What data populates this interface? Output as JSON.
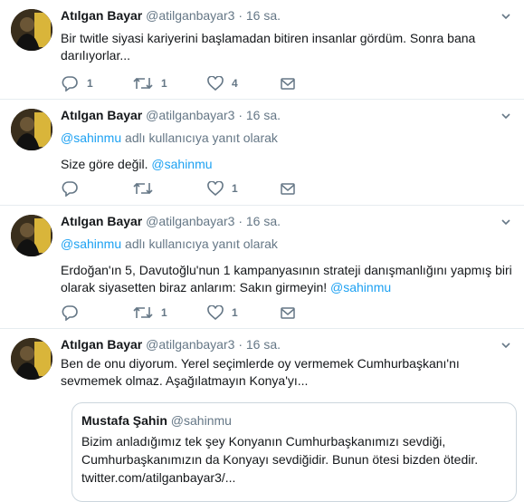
{
  "colors": {
    "link": "#1da1f2",
    "muted": "#657786",
    "border": "#e6ecf0"
  },
  "tweets": [
    {
      "name": "Atılgan Bayar",
      "handle": "@atilganbayar3",
      "dot": "·",
      "time": "16 sa.",
      "replying_prefix": "",
      "replying_handle": "",
      "replying_suffix": "",
      "text": "Bir twitle siyasi kariyerini başlamadan bitiren insanlar gördüm. Sonra bana darılıyorlar...",
      "text_link": "",
      "reply_count": "1",
      "retweet_count": "1",
      "like_count": "4"
    },
    {
      "name": "Atılgan Bayar",
      "handle": "@atilganbayar3",
      "dot": "·",
      "time": "16 sa.",
      "replying_prefix": "",
      "replying_handle": "@sahinmu",
      "replying_suffix": " adlı kullanıcıya yanıt olarak",
      "text": "Size göre değil. ",
      "text_link": "@sahinmu",
      "reply_count": "",
      "retweet_count": "",
      "like_count": "1"
    },
    {
      "name": "Atılgan Bayar",
      "handle": "@atilganbayar3",
      "dot": "·",
      "time": "16 sa.",
      "replying_prefix": "",
      "replying_handle": "@sahinmu",
      "replying_suffix": " adlı kullanıcıya yanıt olarak",
      "text": "Erdoğan'ın 5, Davutoğlu'nun 1 kampanyasının strateji danışmanlığını yapmış biri olarak siyasetten biraz anlarım: Sakın girmeyin! ",
      "text_link": "@sahinmu",
      "reply_count": "",
      "retweet_count": "1",
      "like_count": "1"
    },
    {
      "name": "Atılgan Bayar",
      "handle": "@atilganbayar3",
      "dot": "·",
      "time": "16 sa.",
      "text": "Ben de onu diyorum. Yerel seçimlerde oy vermemek Cumhurbaşkanı'nı sevmemek olmaz. Aşağılatmayın Konya'yı..."
    }
  ],
  "quote": {
    "name": "Mustafa Şahin",
    "handle": "@sahinmu",
    "text": "Bizim anladığımız tek şey Konyanın Cumhurbaşkanımızı sevdiği, Cumhurbaşkanımızın da Konyayı sevdiğidir. Bunun ötesi bizden ötedir.",
    "link": "twitter.com/atilganbayar3/..."
  }
}
